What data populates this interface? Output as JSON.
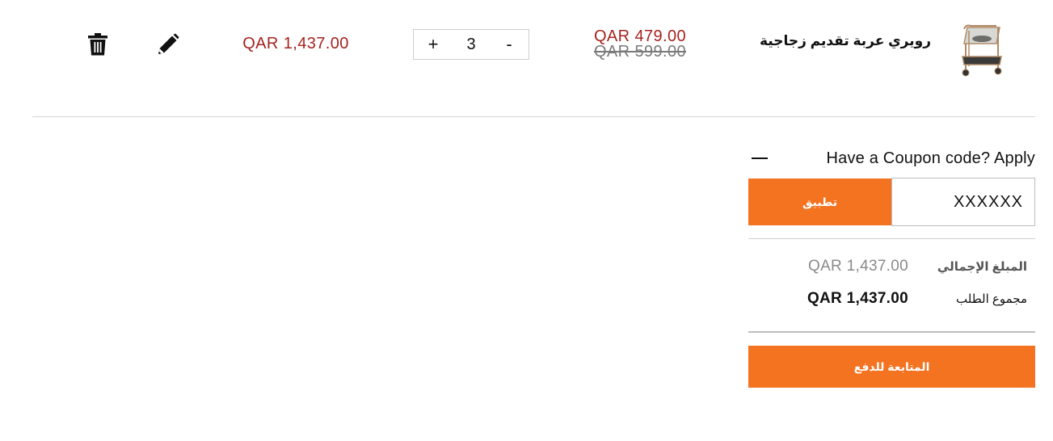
{
  "cart_item": {
    "product_name": "رويري عربة تقديم زجاجية",
    "unit_price": "QAR  479.00",
    "original_price": "QAR  599.00",
    "quantity": "3",
    "qty_increase_label": "+",
    "qty_decrease_label": "-",
    "row_total": "QAR  1,437.00",
    "thumbnail_icon": "serving-cart-thumbnail",
    "edit_icon": "pencil-icon",
    "delete_icon": "trash-icon"
  },
  "coupon": {
    "toggle_label": "Have a Coupon code? Apply",
    "toggle_icon": "minus-icon",
    "input_value": "XXXXXX",
    "apply_label": "تطبيق"
  },
  "summary": {
    "subtotal_label": "المبلغ الإجمالي",
    "subtotal_value": "QAR  1,437.00",
    "grand_total_label": "مجموع الطلب",
    "grand_total_value": "QAR  1,437.00"
  },
  "checkout": {
    "label": "المتابعة للدفع"
  },
  "colors": {
    "accent_orange": "#f37321",
    "price_red": "#a5231f",
    "muted_gray": "#7a7a7a"
  }
}
